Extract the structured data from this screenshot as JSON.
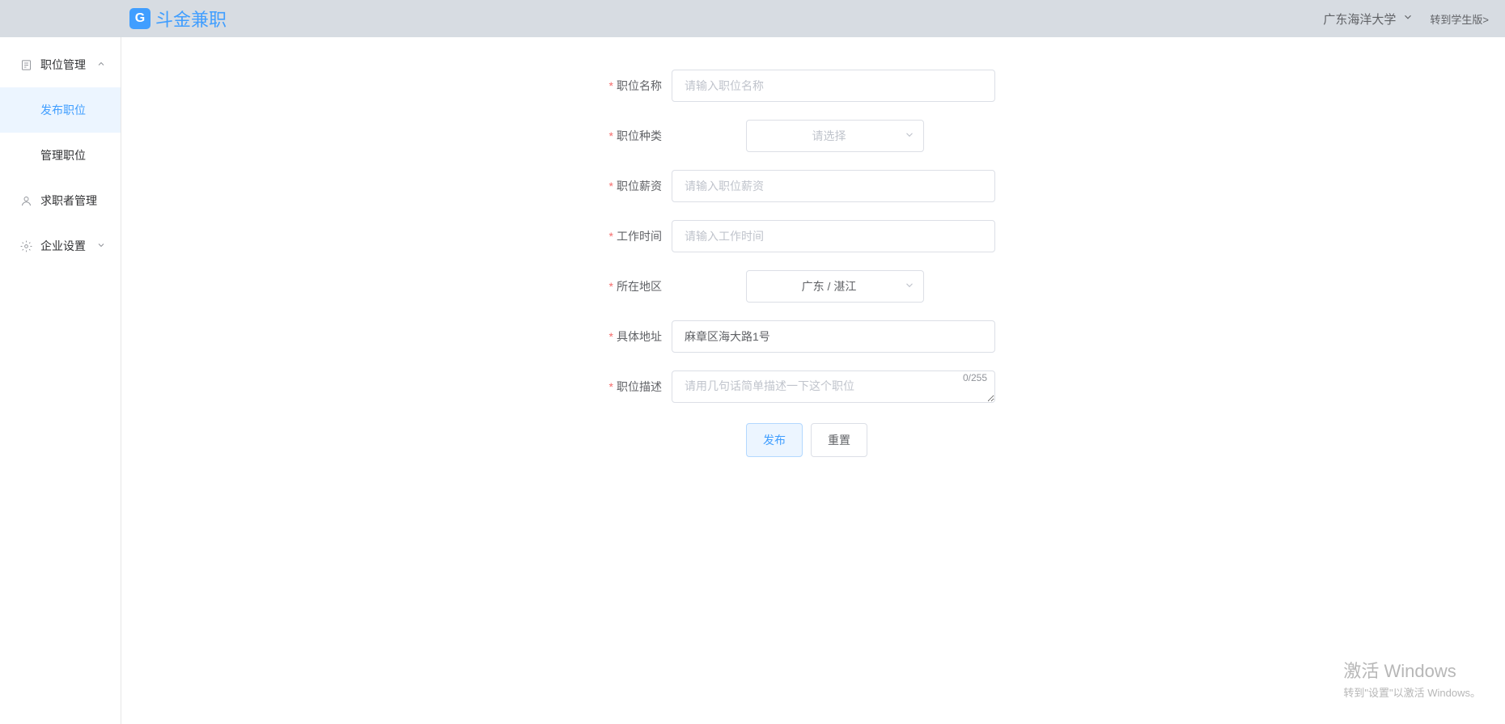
{
  "header": {
    "logo_text": "斗金兼职",
    "school": "广东海洋大学",
    "switch_link": "转到学生版>"
  },
  "sidebar": {
    "menu1": "职位管理",
    "sub1": "发布职位",
    "sub2": "管理职位",
    "menu2": "求职者管理",
    "menu3": "企业设置"
  },
  "form": {
    "name": {
      "label": "职位名称",
      "placeholder": "请输入职位名称",
      "value": ""
    },
    "type": {
      "label": "职位种类",
      "placeholder": "请选择",
      "value": ""
    },
    "salary": {
      "label": "职位薪资",
      "placeholder": "请输入职位薪资",
      "value": ""
    },
    "worktime": {
      "label": "工作时间",
      "placeholder": "请输入工作时间",
      "value": ""
    },
    "region": {
      "label": "所在地区",
      "value": "广东 / 湛江"
    },
    "address": {
      "label": "具体地址",
      "value": "麻章区海大路1号"
    },
    "desc": {
      "label": "职位描述",
      "placeholder": "请用几句话简单描述一下这个职位",
      "value": "",
      "count": "0/255"
    }
  },
  "buttons": {
    "publish": "发布",
    "reset": "重置"
  },
  "watermark": {
    "title": "激活 Windows",
    "sub": "转到\"设置\"以激活 Windows。"
  }
}
